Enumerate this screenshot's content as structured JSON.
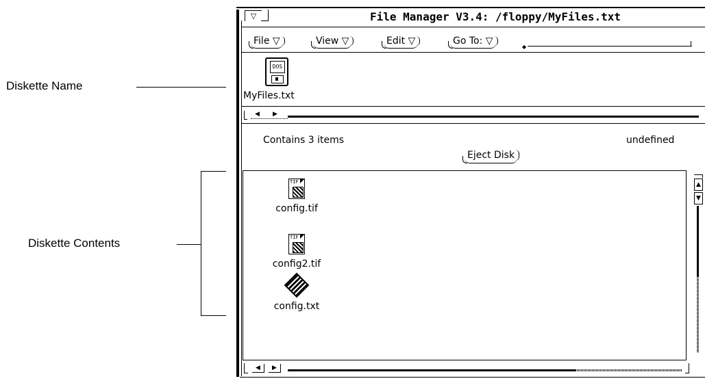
{
  "callouts": {
    "diskette_name": "Diskette Name",
    "diskette_contents": "Diskette Contents"
  },
  "window": {
    "title": "File Manager V3.4: /floppy/MyFiles.txt",
    "menu_glyph": "▽"
  },
  "menu": {
    "file": "File ▽",
    "view": "View ▽",
    "edit": "Edit ▽",
    "goto": "Go To: ▽"
  },
  "disk": {
    "icon_label": "DOS",
    "name": "MyFiles.txt"
  },
  "status": {
    "item_count": "Contains 3 items",
    "eject_button": "Eject Disk",
    "right_text": "undefined"
  },
  "files": [
    {
      "name": "config.tif",
      "icon": "tif-file-icon",
      "tag": "TIF"
    },
    {
      "name": "config2.tif",
      "icon": "tif-file-icon",
      "tag": "TIF"
    },
    {
      "name": "config.txt",
      "icon": "text-file-icon"
    }
  ],
  "scroll": {
    "left_arrow": "◀",
    "right_arrow": "▶",
    "up_arrow": "▲",
    "down_arrow": "▼"
  }
}
